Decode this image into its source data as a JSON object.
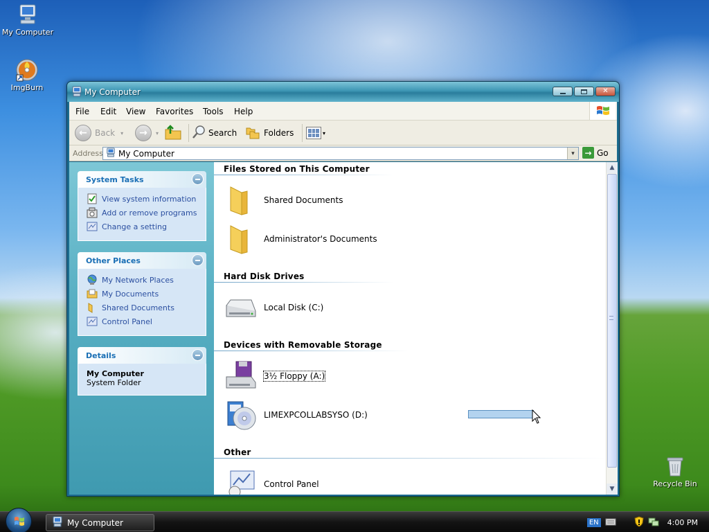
{
  "desktop": {
    "icons": [
      {
        "label": "My Computer",
        "icon": "computer-icon"
      },
      {
        "label": "ImgBurn",
        "icon": "imgburn-icon"
      },
      {
        "label": "Recycle Bin",
        "icon": "recycle-bin-icon"
      }
    ]
  },
  "window": {
    "title": "My Computer",
    "menu": [
      "File",
      "Edit",
      "View",
      "Favorites",
      "Tools",
      "Help"
    ],
    "toolbar": {
      "back": "Back",
      "search": "Search",
      "folders": "Folders"
    },
    "address": {
      "label": "Address",
      "value": "My Computer",
      "go": "Go"
    }
  },
  "taskpane": {
    "system_tasks": {
      "title": "System Tasks",
      "items": [
        "View system information",
        "Add or remove programs",
        "Change a setting"
      ]
    },
    "other_places": {
      "title": "Other Places",
      "items": [
        "My Network Places",
        "My Documents",
        "Shared Documents",
        "Control Panel"
      ]
    },
    "details": {
      "title": "Details",
      "name": "My Computer",
      "type": "System Folder"
    }
  },
  "content": {
    "groups": [
      {
        "title": "Files Stored on This Computer",
        "items": [
          "Shared Documents",
          "Administrator's Documents"
        ]
      },
      {
        "title": "Hard Disk Drives",
        "items": [
          "Local Disk (C:)"
        ]
      },
      {
        "title": "Devices with Removable Storage",
        "items": [
          "3½ Floppy (A:)",
          "LIMEXPCOLLABSYSO (D:)"
        ]
      },
      {
        "title": "Other",
        "items": [
          "Control Panel"
        ]
      }
    ]
  },
  "taskbar": {
    "window_button": "My Computer",
    "language": "EN",
    "clock": "4:00 PM"
  },
  "colors": {
    "taskpane_link": "#2b4fa0",
    "panel_title": "#1a6fb5",
    "titlebar": "#3d96b4"
  }
}
